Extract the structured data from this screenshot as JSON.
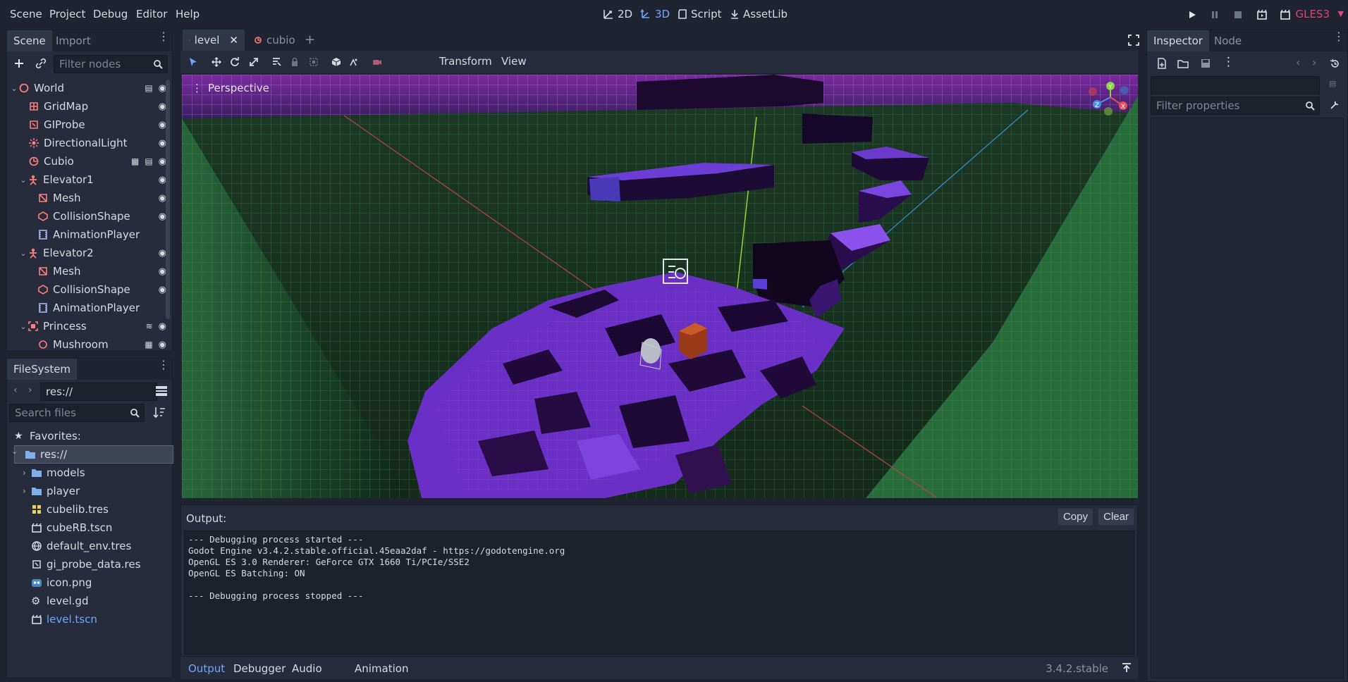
{
  "menubar": {
    "menus": [
      "Scene",
      "Project",
      "Debug",
      "Editor",
      "Help"
    ],
    "modes": [
      "2D",
      "3D",
      "Script",
      "AssetLib"
    ],
    "active_mode": "3D",
    "renderer": "GLES3"
  },
  "scene_dock": {
    "tabs": [
      "Scene",
      "Import"
    ],
    "filter_placeholder": "Filter nodes",
    "nodes": [
      {
        "name": "World",
        "icon": "spatial-node-icon",
        "color": "#fc7f7f"
      },
      {
        "name": "GridMap",
        "icon": "gridmap-icon",
        "color": "#fc7f7f"
      },
      {
        "name": "GIProbe",
        "icon": "giprobe-icon",
        "color": "#fc7f7f"
      },
      {
        "name": "DirectionalLight",
        "icon": "directional-light-icon",
        "color": "#fc7f7f"
      },
      {
        "name": "Cubio",
        "icon": "instanced-scene-icon",
        "color": "#fc7f7f"
      },
      {
        "name": "Elevator1",
        "icon": "kinematic-body-icon",
        "color": "#fc7f7f"
      },
      {
        "name": "Mesh",
        "icon": "mesh-instance-icon",
        "color": "#fc7f7f"
      },
      {
        "name": "CollisionShape",
        "icon": "collision-shape-icon",
        "color": "#fc7f7f"
      },
      {
        "name": "AnimationPlayer",
        "icon": "animation-player-icon",
        "color": "#a5b7f3"
      },
      {
        "name": "Elevator2",
        "icon": "kinematic-body-icon",
        "color": "#fc7f7f"
      },
      {
        "name": "Mesh",
        "icon": "mesh-instance-icon",
        "color": "#fc7f7f"
      },
      {
        "name": "CollisionShape",
        "icon": "collision-shape-icon",
        "color": "#fc7f7f"
      },
      {
        "name": "AnimationPlayer",
        "icon": "animation-player-icon",
        "color": "#a5b7f3"
      },
      {
        "name": "Princess",
        "icon": "area-icon",
        "color": "#fc7f7f"
      },
      {
        "name": "Mushroom",
        "icon": "collision-shape-icon",
        "color": "#fc7f7f"
      }
    ]
  },
  "filesystem": {
    "tab": "FileSystem",
    "path": "res://",
    "search_placeholder": "Search files",
    "favorites_label": "Favorites:",
    "items": [
      {
        "name": "res://",
        "icon": "folder-icon",
        "selected": true
      },
      {
        "name": "models",
        "icon": "folder-icon"
      },
      {
        "name": "player",
        "icon": "folder-icon"
      },
      {
        "name": "cubelib.tres",
        "icon": "meshlib-icon"
      },
      {
        "name": "cubeRB.tscn",
        "icon": "scene-file-icon"
      },
      {
        "name": "default_env.tres",
        "icon": "environment-icon"
      },
      {
        "name": "gi_probe_data.res",
        "icon": "giprobe-data-icon"
      },
      {
        "name": "icon.png",
        "icon": "image-icon"
      },
      {
        "name": "level.gd",
        "icon": "gear-icon"
      },
      {
        "name": "level.tscn",
        "icon": "scene-file-icon",
        "highlight": true
      }
    ]
  },
  "editor_tabs": [
    {
      "label": "level",
      "active": true
    },
    {
      "label": "cubio",
      "active": false
    }
  ],
  "viewport": {
    "menus": [
      "Transform",
      "View"
    ],
    "perspective_label": "Perspective",
    "gizmo_axes": [
      "Y",
      "Z",
      "X"
    ]
  },
  "output": {
    "title": "Output:",
    "copy_label": "Copy",
    "clear_label": "Clear",
    "lines": [
      {
        "text": "--- Debugging process started ---",
        "dim": true
      },
      {
        "text": "Godot Engine v3.4.2.stable.official.45eaa2daf - https://godotengine.org"
      },
      {
        "text": "OpenGL ES 3.0 Renderer: GeForce GTX 1660 Ti/PCIe/SSE2"
      },
      {
        "text": "OpenGL ES Batching: ON"
      },
      {
        "text": ""
      },
      {
        "text": "--- Debugging process stopped ---",
        "dim": true
      }
    ]
  },
  "bottom_tabs": [
    "Output",
    "Debugger",
    "Audio",
    "Animation"
  ],
  "version": "3.4.2.stable",
  "inspector": {
    "tabs": [
      "Inspector",
      "Node"
    ],
    "filter_placeholder": "Filter properties"
  },
  "colors": {
    "accent": "#6fa8ff",
    "renderer": "#e3427a",
    "node_red": "#fc7f7f",
    "anim_blue": "#a5b7f3"
  }
}
